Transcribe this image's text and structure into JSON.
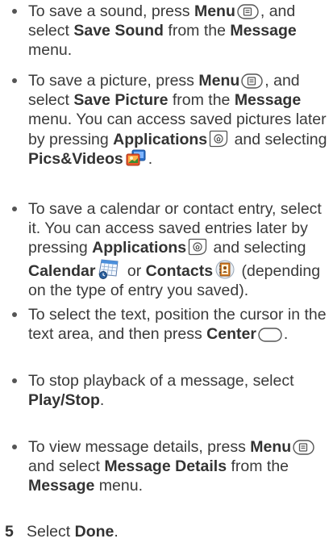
{
  "bullets": [
    {
      "parts": [
        {
          "t": "To save a sound, press "
        },
        {
          "t": "Menu",
          "b": true
        },
        {
          "icon": "menu-key-icon"
        },
        {
          "t": ", and select "
        },
        {
          "t": "Save Sound",
          "b": true
        },
        {
          "t": " from the "
        },
        {
          "t": "Message",
          "b": true
        },
        {
          "t": " menu."
        }
      ]
    },
    {
      "parts": [
        {
          "t": "To save a picture, press "
        },
        {
          "t": "Menu",
          "b": true
        },
        {
          "icon": "menu-key-icon"
        },
        {
          "t": ", and select "
        },
        {
          "t": "Save Picture",
          "b": true
        },
        {
          "t": " from the "
        },
        {
          "t": "Message",
          "b": true
        },
        {
          "t": " menu. You can access saved pictures later by pressing "
        },
        {
          "t": "Applications",
          "b": true
        },
        {
          "icon": "applications-key-icon"
        },
        {
          "t": " and selecting "
        },
        {
          "t": "Pics&Videos",
          "b": true
        },
        {
          "icon": "pics-videos-app-icon"
        },
        {
          "t": "."
        }
      ]
    },
    {
      "parts": [
        {
          "t": "To save a calendar or contact entry, select it. You can access saved entries later by pressing "
        },
        {
          "t": "Applications",
          "b": true
        },
        {
          "icon": "applications-key-icon"
        },
        {
          "t": " and selecting "
        },
        {
          "t": "Calendar",
          "b": true
        },
        {
          "icon": "calendar-app-icon"
        },
        {
          "t": " or "
        },
        {
          "t": "Contacts",
          "b": true
        },
        {
          "icon": "contacts-app-icon"
        },
        {
          "t": " (depending on the type of entry you saved)."
        }
      ]
    },
    {
      "parts": [
        {
          "t": "To select the text, position the cursor in the text area, and then press "
        },
        {
          "t": "Center",
          "b": true
        },
        {
          "icon": "center-key-icon"
        },
        {
          "t": "."
        }
      ]
    },
    {
      "parts": [
        {
          "t": "To stop playback of a message, select "
        },
        {
          "t": "Play/Stop",
          "b": true
        },
        {
          "t": "."
        }
      ]
    },
    {
      "parts": [
        {
          "t": "To view message details, press "
        },
        {
          "t": "Menu",
          "b": true
        },
        {
          "icon": "menu-key-icon"
        },
        {
          "t": " and select "
        },
        {
          "t": "Message Details",
          "b": true
        },
        {
          "t": " from the "
        },
        {
          "t": "Message",
          "b": true
        },
        {
          "t": " menu."
        }
      ]
    }
  ],
  "step": {
    "number": "5",
    "text_before": "Select ",
    "action": "Done",
    "text_after": "."
  }
}
